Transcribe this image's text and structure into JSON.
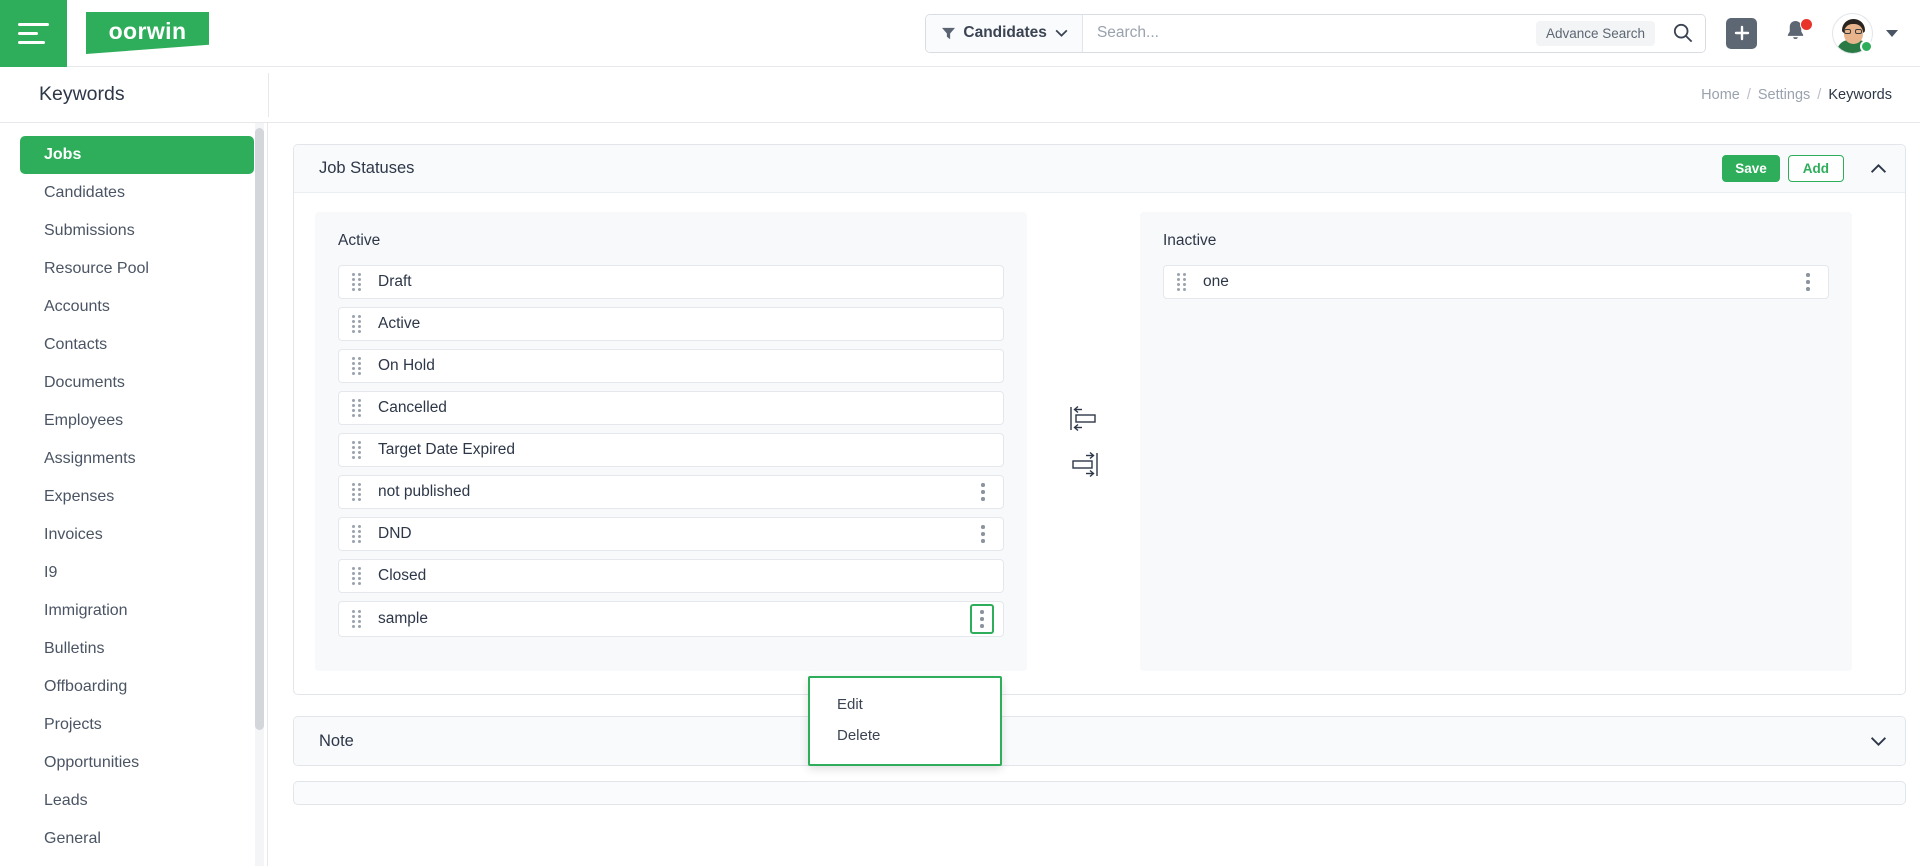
{
  "topbar": {
    "menu_icon": "hamburger-icon",
    "logo_text": "oorwin",
    "search_filter_label": "Candidates",
    "search_placeholder": "Search...",
    "search_value": "",
    "advance_search_label": "Advance Search",
    "search_icon": "search-icon",
    "add_icon": "plus-icon",
    "notifications_icon": "bell-icon",
    "avatar_icon": "user-avatar",
    "profile_caret_icon": "caret-down-icon"
  },
  "subheader": {
    "page_title": "Keywords",
    "breadcrumb": [
      {
        "label": "Home",
        "current": false
      },
      {
        "label": "Settings",
        "current": false
      },
      {
        "label": "Keywords",
        "current": true
      }
    ],
    "separator": "/"
  },
  "sidebar": {
    "items": [
      {
        "label": "Jobs",
        "active": true
      },
      {
        "label": "Candidates",
        "active": false
      },
      {
        "label": "Submissions",
        "active": false
      },
      {
        "label": "Resource Pool",
        "active": false
      },
      {
        "label": "Accounts",
        "active": false
      },
      {
        "label": "Contacts",
        "active": false
      },
      {
        "label": "Documents",
        "active": false
      },
      {
        "label": "Employees",
        "active": false
      },
      {
        "label": "Assignments",
        "active": false
      },
      {
        "label": "Expenses",
        "active": false
      },
      {
        "label": "Invoices",
        "active": false
      },
      {
        "label": "I9",
        "active": false
      },
      {
        "label": "Immigration",
        "active": false
      },
      {
        "label": "Bulletins",
        "active": false
      },
      {
        "label": "Offboarding",
        "active": false
      },
      {
        "label": "Projects",
        "active": false
      },
      {
        "label": "Opportunities",
        "active": false
      },
      {
        "label": "Leads",
        "active": false
      },
      {
        "label": "General",
        "active": false
      }
    ]
  },
  "job_statuses": {
    "title": "Job Statuses",
    "save_label": "Save",
    "add_label": "Add",
    "collapse_icon": "chevron-up-icon",
    "active_panel": {
      "title": "Active",
      "rows": [
        {
          "label": "Draft",
          "has_kebab": false,
          "menu_open": false
        },
        {
          "label": "Active",
          "has_kebab": false,
          "menu_open": false
        },
        {
          "label": "On Hold",
          "has_kebab": false,
          "menu_open": false
        },
        {
          "label": "Cancelled",
          "has_kebab": false,
          "menu_open": false
        },
        {
          "label": "Target Date Expired",
          "has_kebab": false,
          "menu_open": false
        },
        {
          "label": "not published",
          "has_kebab": true,
          "menu_open": false
        },
        {
          "label": "DND",
          "has_kebab": true,
          "menu_open": false
        },
        {
          "label": "Closed",
          "has_kebab": false,
          "menu_open": false
        },
        {
          "label": "sample",
          "has_kebab": true,
          "menu_open": true
        }
      ]
    },
    "inactive_panel": {
      "title": "Inactive",
      "rows": [
        {
          "label": "one",
          "has_kebab": true,
          "menu_open": false
        }
      ]
    },
    "transfer": {
      "move_left_icon": "move-to-active-icon",
      "move_right_icon": "move-to-inactive-icon"
    }
  },
  "context_menu": {
    "items": [
      {
        "label": "Edit"
      },
      {
        "label": "Delete"
      }
    ]
  },
  "note_card": {
    "title": "Note",
    "expand_icon": "chevron-down-icon"
  },
  "colors": {
    "brand_green": "#2eae5b",
    "text_dark": "#2d3748",
    "muted": "#9aa2ae",
    "panel_bg": "#f8f9fa",
    "notification_red": "#e8342a"
  }
}
